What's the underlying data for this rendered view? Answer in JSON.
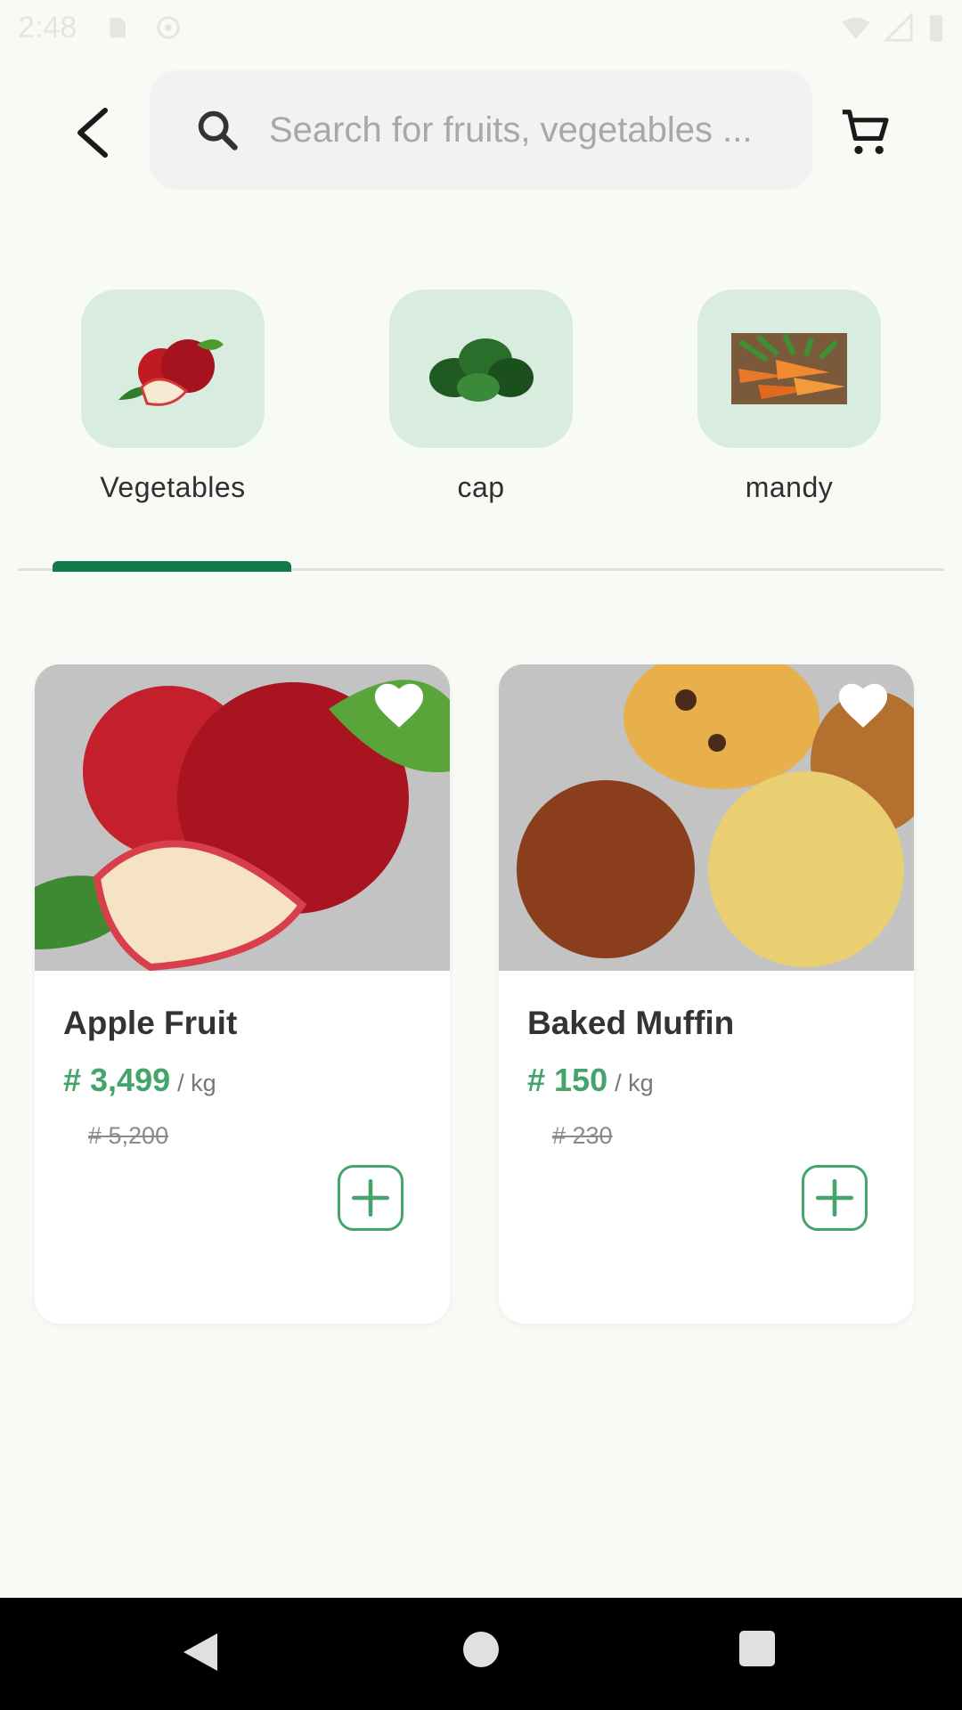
{
  "status_bar": {
    "time": "2:48"
  },
  "search": {
    "placeholder": "Search for fruits, vegetables ..."
  },
  "categories": [
    {
      "label": "Vegetables",
      "icon": "apple-image",
      "selected": true
    },
    {
      "label": "cap",
      "icon": "spinach-image",
      "selected": false
    },
    {
      "label": "mandy",
      "icon": "carrots-image",
      "selected": false
    }
  ],
  "products": [
    {
      "name": "Apple Fruit",
      "price": "# 3,499",
      "unit": "/ kg",
      "old_price": "# 5,200",
      "image": "apple-photo"
    },
    {
      "name": "Baked Muffin",
      "price": "# 150",
      "unit": "/ kg",
      "old_price": "# 230",
      "image": "muffin-photo"
    }
  ],
  "colors": {
    "accent": "#45a46c",
    "tab_indicator": "#127a46",
    "category_tile": "#d9ece0",
    "background": "#f8faf6"
  }
}
